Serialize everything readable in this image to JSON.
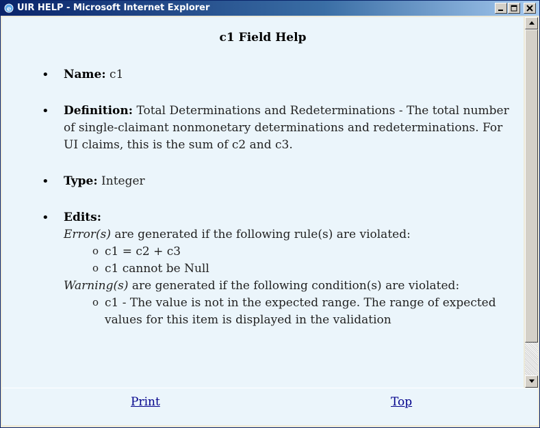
{
  "window": {
    "title": "UIR HELP - Microsoft Internet Explorer",
    "icon": "ie-icon",
    "buttons": [
      "minimize-icon",
      "maximize-icon",
      "close-icon"
    ]
  },
  "help": {
    "title": "c1 Field Help",
    "name_label": "Name:",
    "name_value": "c1",
    "definition_label": "Definition:",
    "definition_value": "Total Determinations and Redeterminations - The total number of single-claimant nonmonetary determinations and redeterminations. For UI claims, this is the sum of c2 and c3.",
    "type_label": "Type:",
    "type_value": "Integer",
    "edits_label": "Edits:",
    "errors_intro_em": "Error(s)",
    "errors_intro_rest": " are generated if the following rule(s) are violated:",
    "errors": [
      "c1 = c2 + c3",
      "c1 cannot be Null"
    ],
    "warnings_intro_em": "Warning(s)",
    "warnings_intro_rest": " are generated if the following condition(s) are violated:",
    "warnings": [
      "c1 - The value is not in the expected range. The range of expected values for this item is displayed in the validation"
    ]
  },
  "footer": {
    "print_label": "Print",
    "top_label": "Top"
  },
  "colors": {
    "content_bg": "#EBF5FB",
    "link": "#00008B",
    "titlebar": "#0A246A"
  }
}
